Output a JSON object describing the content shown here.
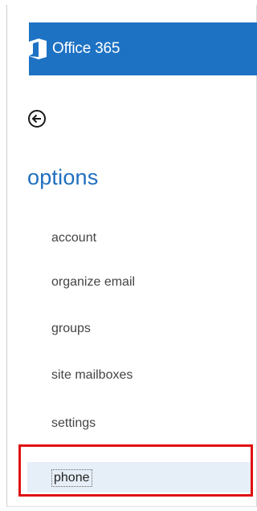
{
  "header": {
    "brand": "Office 365",
    "brand_color": "#1e72c4"
  },
  "back": {
    "icon": "arrow-left-circle-icon"
  },
  "page": {
    "title": "options",
    "title_color": "#1f6fbf"
  },
  "menu": {
    "items": [
      {
        "label": "account"
      },
      {
        "label": "organize email"
      },
      {
        "label": "groups"
      },
      {
        "label": "site mailboxes"
      },
      {
        "label": "settings"
      },
      {
        "label": "phone",
        "selected": true
      }
    ]
  },
  "annotation": {
    "highlight_color": "#e01010"
  }
}
